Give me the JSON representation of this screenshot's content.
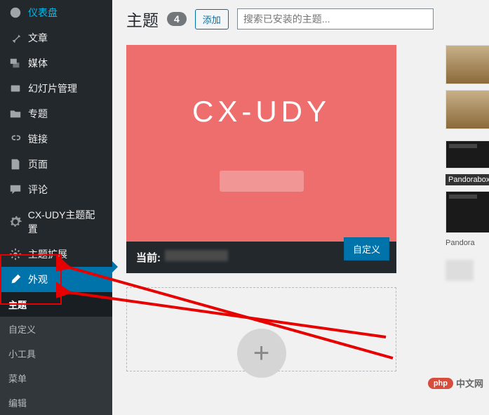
{
  "sidebar": {
    "items": [
      {
        "label": "仪表盘",
        "icon": "dashboard-icon"
      },
      {
        "label": "文章",
        "icon": "pin-icon"
      },
      {
        "label": "媒体",
        "icon": "media-icon"
      },
      {
        "label": "幻灯片管理",
        "icon": "slides-icon"
      },
      {
        "label": "专题",
        "icon": "folder-icon"
      },
      {
        "label": "链接",
        "icon": "link-icon"
      },
      {
        "label": "页面",
        "icon": "page-icon"
      },
      {
        "label": "评论",
        "icon": "comment-icon"
      },
      {
        "label": "CX-UDY主题配置",
        "icon": "gear-icon"
      },
      {
        "label": "主题扩展",
        "icon": "gear-icon"
      },
      {
        "label": "外观",
        "icon": "brush-icon",
        "active": true
      }
    ],
    "submenu": [
      {
        "label": "主题",
        "current": true
      },
      {
        "label": "自定义"
      },
      {
        "label": "小工具"
      },
      {
        "label": "菜单"
      },
      {
        "label": "编辑"
      }
    ]
  },
  "header": {
    "title": "主题",
    "count": "4",
    "add_label": "添加",
    "search_placeholder": "搜索已安装的主题..."
  },
  "theme": {
    "thumb_text": "CX-UDY",
    "current_prefix": "当前:",
    "customize_label": "自定义"
  },
  "side_themes": {
    "label1": "",
    "label2_prefix": "Pandorabox",
    "label3": "Pandora"
  },
  "watermark": {
    "badge": "php",
    "text": "中文网"
  }
}
